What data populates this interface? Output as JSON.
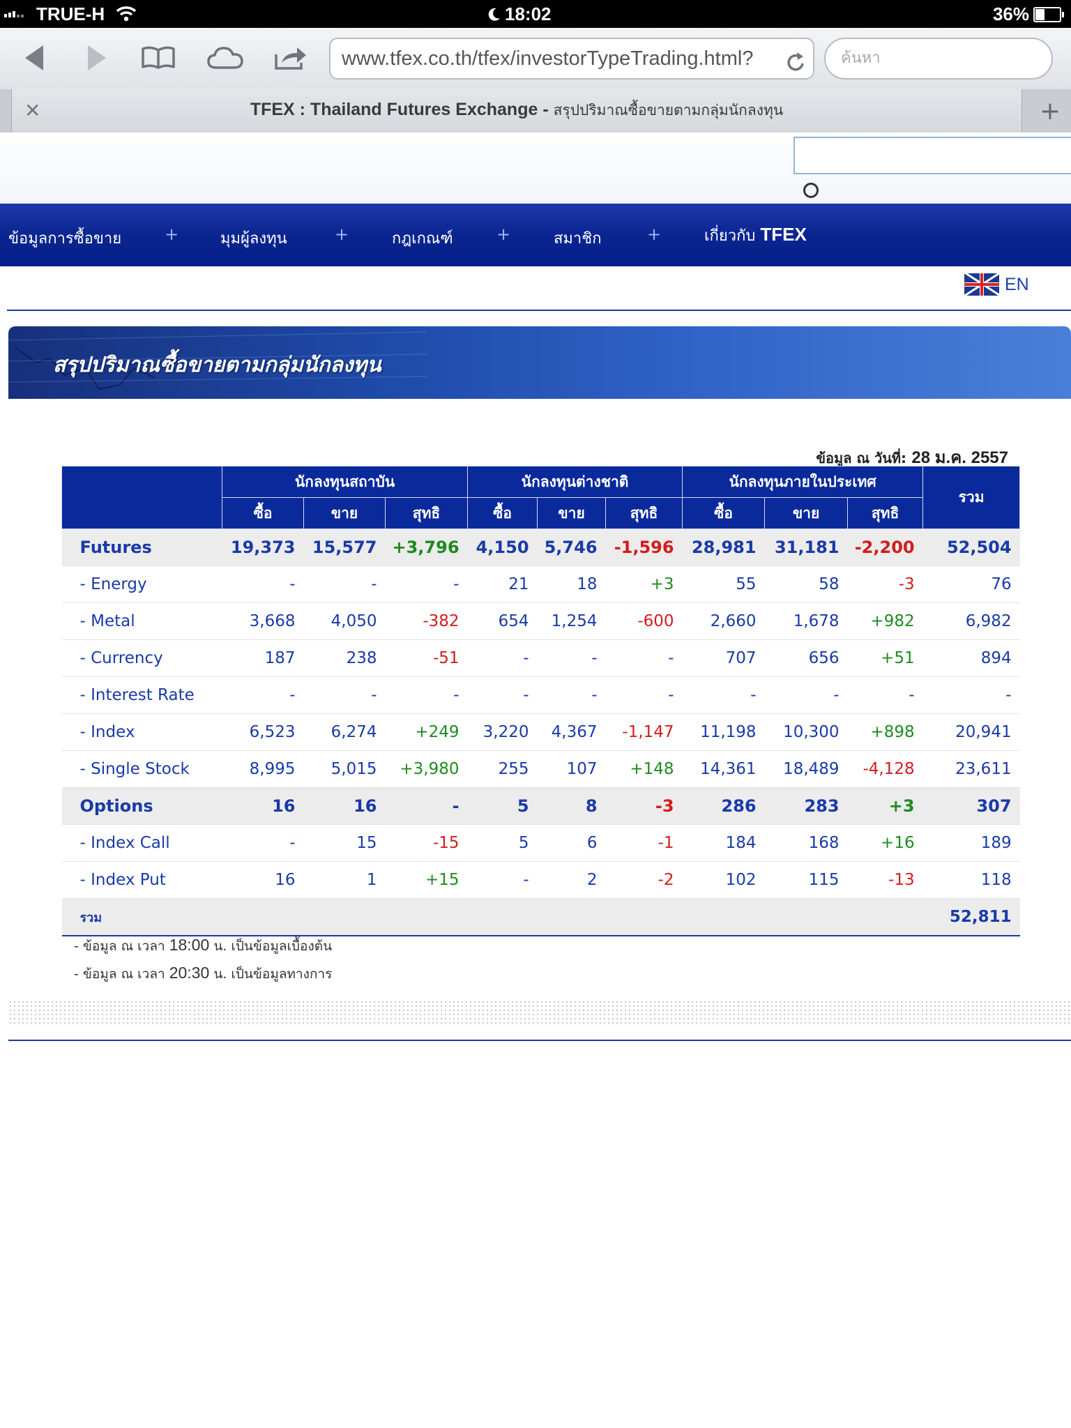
{
  "status": {
    "carrier": "TRUE-H",
    "time": "18:02",
    "battery": "36%",
    "battery_level": 0.36
  },
  "browser": {
    "url": "www.tfex.co.th/tfex/investorTypeTrading.html?",
    "search_placeholder": "ค้นหา",
    "tab_title_bold": "TFEX : Thailand Futures Exchange -",
    "tab_title_thai": "สรุปปริมาณซื้อขายตามกลุ่มนักลงทุน"
  },
  "nav": {
    "item1": "ข้อมูลการซื้อขาย",
    "item2": "มุมผู้ลงทุน",
    "item3": "กฎเกณฑ์",
    "item4": "สมาชิก",
    "item5_prefix": "เกี่ยวกับ",
    "item5_brand": "TFEX",
    "plus": "+"
  },
  "lang": {
    "label": "EN"
  },
  "page": {
    "title": "สรุปปริมาณซื้อขายตามกลุ่มนักลงทุน",
    "asof_label": "ข้อมูล ณ วันที่:",
    "asof_date": "28 ม.ค. 2557"
  },
  "table": {
    "group_headers": [
      "นักลงทุนสถาบัน",
      "นักลงทุนต่างชาติ",
      "นักลงทุนภายในประเทศ"
    ],
    "total_header": "รวม",
    "sub_headers": [
      "ซื้อ",
      "ขาย",
      "สุทธิ"
    ],
    "rows": [
      {
        "label": "Futures",
        "values": [
          "19,373",
          "15,577",
          "+3,796",
          "4,150",
          "5,746",
          "-1,596",
          "28,981",
          "31,181",
          "-2,200",
          "52,504"
        ]
      },
      {
        "label": "- Energy",
        "values": [
          "-",
          "-",
          "-",
          "21",
          "18",
          "+3",
          "55",
          "58",
          "-3",
          "76"
        ]
      },
      {
        "label": "- Metal",
        "values": [
          "3,668",
          "4,050",
          "-382",
          "654",
          "1,254",
          "-600",
          "2,660",
          "1,678",
          "+982",
          "6,982"
        ]
      },
      {
        "label": "- Currency",
        "values": [
          "187",
          "238",
          "-51",
          "-",
          "-",
          "-",
          "707",
          "656",
          "+51",
          "894"
        ]
      },
      {
        "label": "- Interest Rate",
        "values": [
          "-",
          "-",
          "-",
          "-",
          "-",
          "-",
          "-",
          "-",
          "-",
          "-"
        ]
      },
      {
        "label": "- Index",
        "values": [
          "6,523",
          "6,274",
          "+249",
          "3,220",
          "4,367",
          "-1,147",
          "11,198",
          "10,300",
          "+898",
          "20,941"
        ]
      },
      {
        "label": "- Single Stock",
        "values": [
          "8,995",
          "5,015",
          "+3,980",
          "255",
          "107",
          "+148",
          "14,361",
          "18,489",
          "-4,128",
          "23,611"
        ]
      },
      {
        "label": "Options",
        "values": [
          "16",
          "16",
          "-",
          "5",
          "8",
          "-3",
          "286",
          "283",
          "+3",
          "307"
        ]
      },
      {
        "label": "- Index Call",
        "values": [
          "-",
          "15",
          "-15",
          "5",
          "6",
          "-1",
          "184",
          "168",
          "+16",
          "189"
        ]
      },
      {
        "label": "- Index Put",
        "values": [
          "16",
          "1",
          "+15",
          "-",
          "2",
          "-2",
          "102",
          "115",
          "-13",
          "118"
        ]
      }
    ],
    "total_label": "รวม",
    "grand_total": "52,811"
  },
  "notes": {
    "n1_pre": "- ข้อมูล ณ เวลา",
    "n1_time": "18:00",
    "n1_post": "น. เป็นข้อมูลเบื้องต้น",
    "n2_pre": "- ข้อมูล ณ เวลา",
    "n2_time": "20:30",
    "n2_post": "น. เป็นข้อมูลทางการ"
  },
  "colors": {
    "nav_blue": "#0b2590",
    "header_blue": "#0a2a9c",
    "text_blue": "#1a3aa8",
    "positive": "#1e8a1e",
    "negative": "#d41c1c",
    "group_row": "#ececec"
  }
}
